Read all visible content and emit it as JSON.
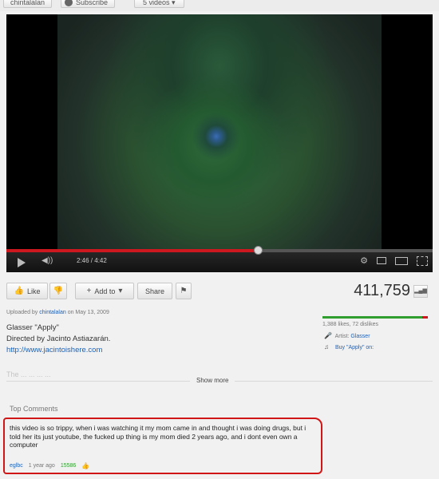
{
  "topbar": {
    "channel": "chintalalan",
    "subscribe_label": "Subscribe",
    "videos_label": "5 videos"
  },
  "player": {
    "time": "2:46 / 4:42",
    "progress": 0.589
  },
  "actions": {
    "like_label": "Like",
    "add_to_label": "Add to",
    "share_label": "Share",
    "views": "411,759"
  },
  "description": {
    "uploaded_prefix": "Uploaded by",
    "uploader": "chintalalan",
    "uploaded_date": "on May 13, 2009",
    "line1": "Glasser \"Apply\"",
    "line2": "Directed by Jacinto Astiazarán.",
    "link": "http://www.jacintoishere.com",
    "faded": "The ... ... ... ..."
  },
  "stats": {
    "likes_text": "1,388 likes, 72 dislikes",
    "like_ratio": 0.95,
    "artist_label": "Artist:",
    "artist": "Glasser",
    "buy_text": "Buy \"Apply\" on:"
  },
  "show_more": "Show more",
  "comments": {
    "heading": "Top Comments",
    "items": [
      {
        "text": "this video is so trippy, when i was watching it my mom came in and thought i was doing drugs, but i told her its just youtube, the fucked up thing is my mom died 2 years ago, and i dont even own a computer",
        "author": "eglbc",
        "age": "1 year ago",
        "score": "15586"
      }
    ]
  },
  "colors": {
    "accent_red": "#cc181e",
    "link_blue": "#1c62b9",
    "like_green": "#2f9e2f",
    "highlight_red": "#d01616"
  }
}
